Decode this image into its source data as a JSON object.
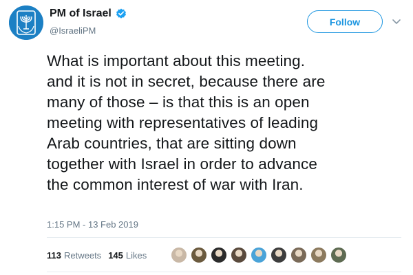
{
  "account": {
    "display_name": "PM of Israel",
    "handle": "@IsraeliPM",
    "avatar_icon": "state-emblem-icon",
    "verified_icon": "verified-badge-icon"
  },
  "actions": {
    "follow_label": "Follow",
    "menu_icon": "chevron-down-icon"
  },
  "tweet": {
    "text": "What is important about this meeting.\nand it is not in secret, because there are\nmany of those – is that this is an open\nmeeting with representatives of leading\nArab countries, that are sitting down\ntogether with Israel in order to advance\nthe common interest of war with Iran.",
    "timestamp": "1:15 PM - 13 Feb 2019"
  },
  "stats": {
    "retweets_count": "113",
    "retweets_label": "Retweets",
    "likes_count": "145",
    "likes_label": "Likes"
  },
  "colors": {
    "accent": "#1b95e0",
    "avatar_bg": "#1c80c4",
    "muted": "#657786",
    "text": "#14171a"
  },
  "liked_by_avatars": [
    {
      "name": "liker-avatar-1",
      "color": "#c9b8a6"
    },
    {
      "name": "liker-avatar-2",
      "color": "#6b5a3e"
    },
    {
      "name": "liker-avatar-3",
      "color": "#2b2b2b"
    },
    {
      "name": "liker-avatar-4",
      "color": "#5a4a3c"
    },
    {
      "name": "liker-avatar-5",
      "color": "#4aa3d8"
    },
    {
      "name": "liker-avatar-6",
      "color": "#3d3d3d"
    },
    {
      "name": "liker-avatar-7",
      "color": "#7a6a58"
    },
    {
      "name": "liker-avatar-8",
      "color": "#8c7a5e"
    },
    {
      "name": "liker-avatar-9",
      "color": "#5e6b52"
    }
  ]
}
